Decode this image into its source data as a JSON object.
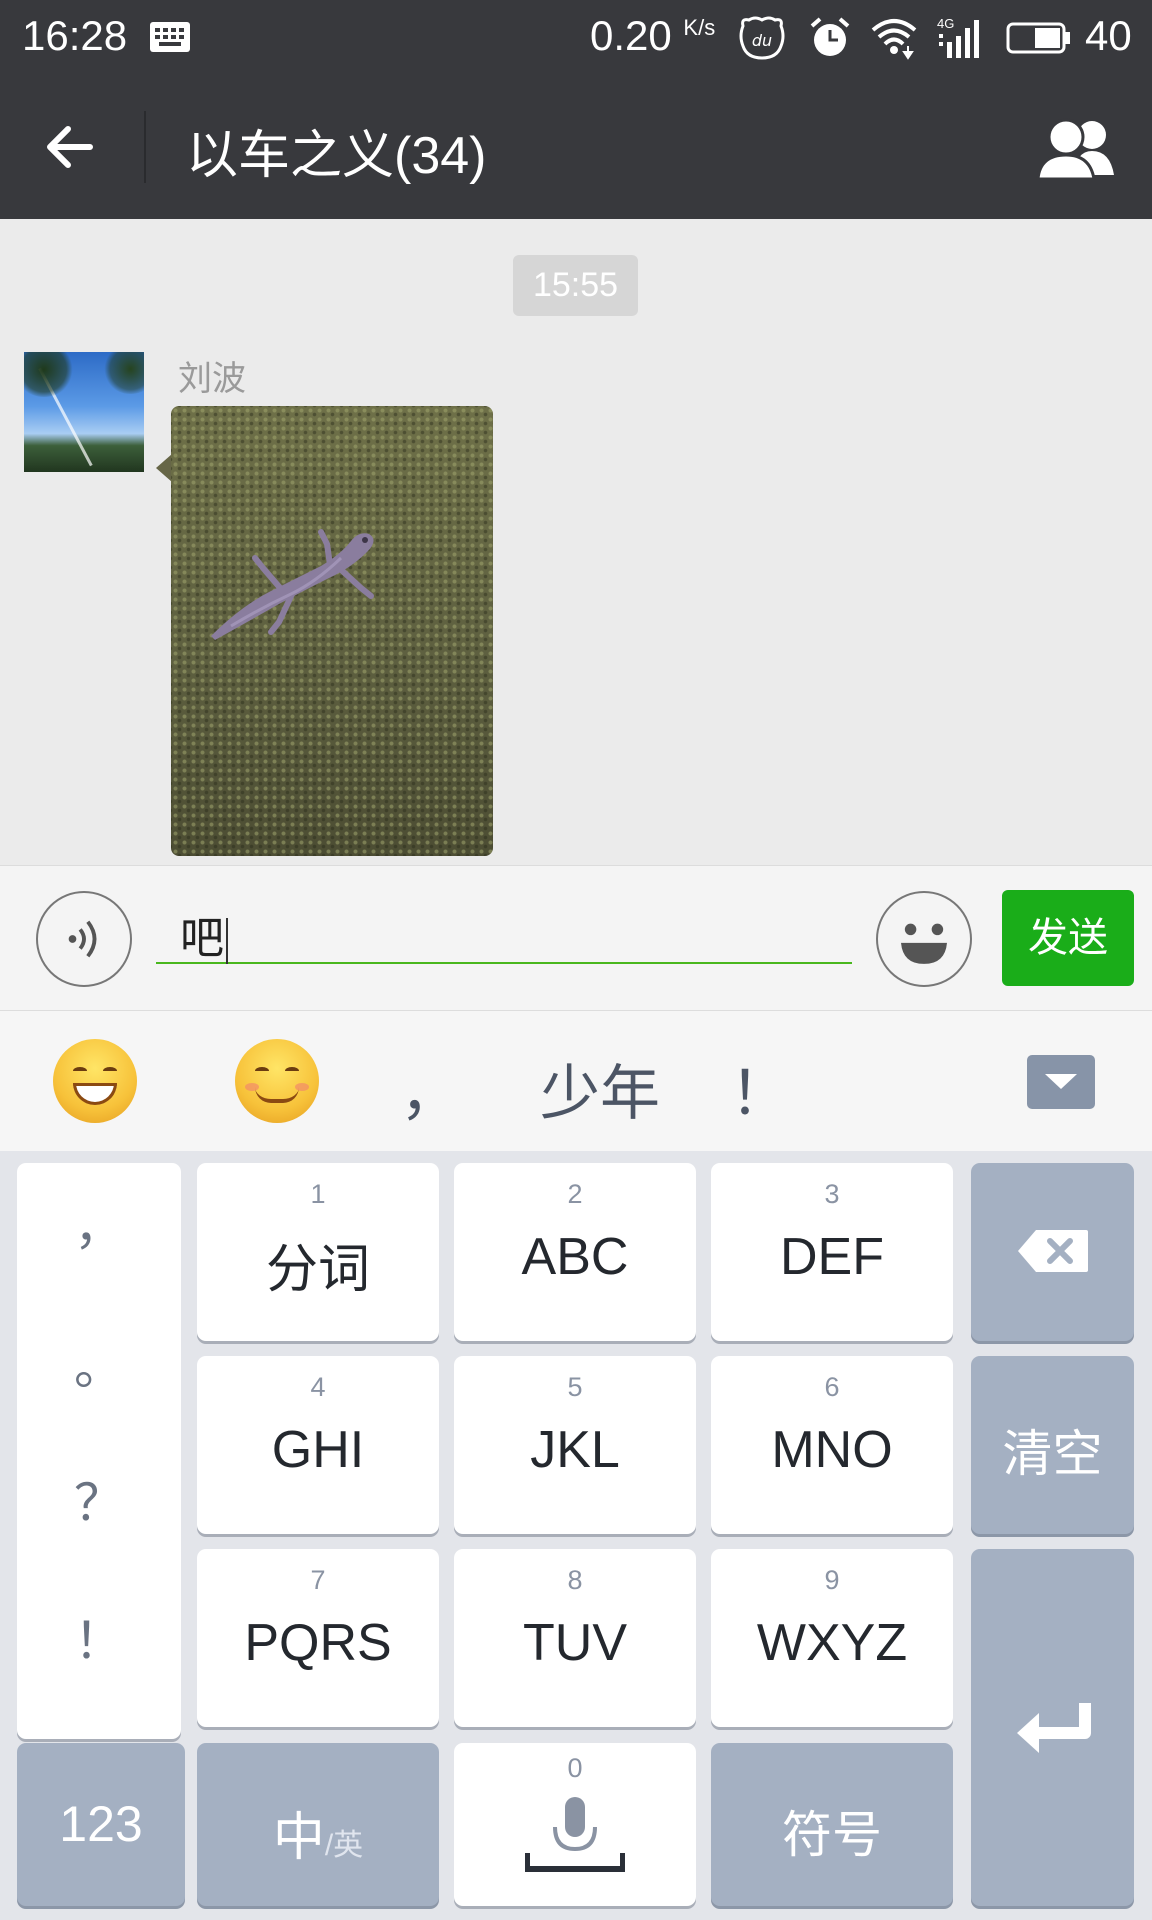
{
  "status_bar": {
    "time": "16:28",
    "net_speed": "0.20",
    "net_unit": "K/s",
    "network_type": "4G",
    "battery": "40"
  },
  "nav": {
    "title": "以车之义(34)"
  },
  "chat": {
    "timestamp": "15:55",
    "messages": [
      {
        "sender": "刘波",
        "type": "image"
      }
    ]
  },
  "input": {
    "value": "吧",
    "send_label": "发送"
  },
  "candidates": {
    "items": [
      "😄",
      "😊",
      "，",
      "少年",
      "！"
    ]
  },
  "keyboard": {
    "punctuation": [
      "，",
      "。",
      "？",
      "！"
    ],
    "keys": [
      {
        "num": "1",
        "label": "分词"
      },
      {
        "num": "2",
        "label": "ABC"
      },
      {
        "num": "3",
        "label": "DEF"
      },
      {
        "num": "4",
        "label": "GHI"
      },
      {
        "num": "5",
        "label": "JKL"
      },
      {
        "num": "6",
        "label": "MNO"
      },
      {
        "num": "7",
        "label": "PQRS"
      },
      {
        "num": "8",
        "label": "TUV"
      },
      {
        "num": "9",
        "label": "WXYZ"
      }
    ],
    "clear_label": "清空",
    "numeric_label": "123",
    "lang_main": "中",
    "lang_alt": "/英",
    "space_num": "0",
    "symbol_label": "符号"
  },
  "colors": {
    "header": "#38393d",
    "send_button": "#1aad19",
    "input_underline": "#49b71d",
    "function_key": "#a4b0c2"
  }
}
